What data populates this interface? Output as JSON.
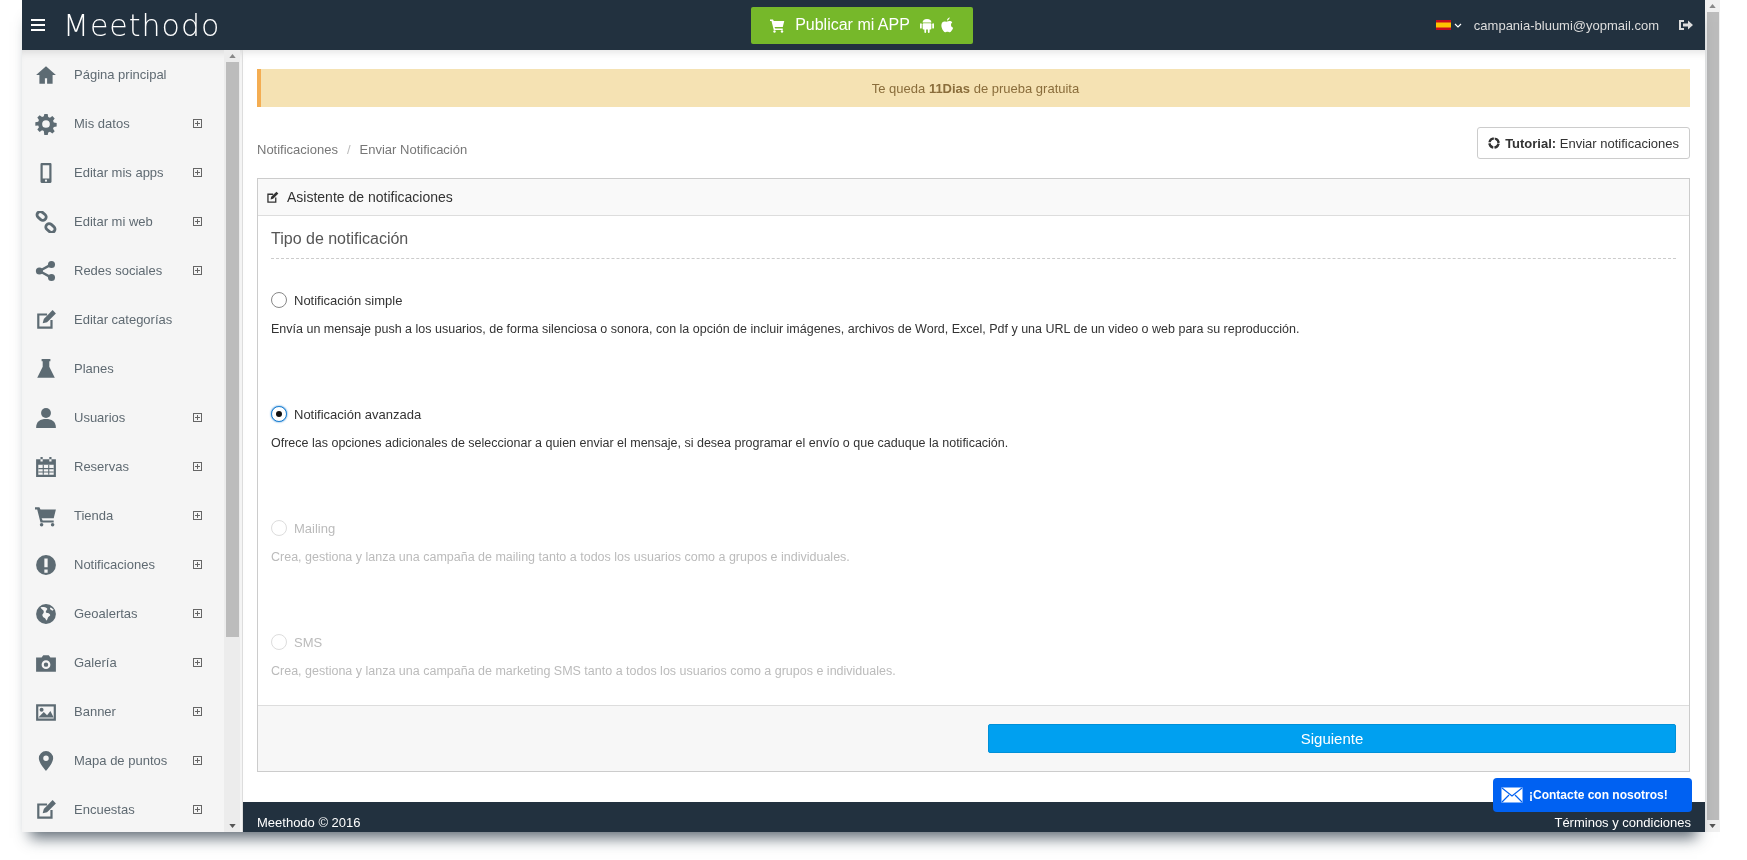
{
  "topbar": {
    "logo": "Meethodo",
    "publish_button": "Publicar mi APP",
    "account_email": "campania-bluumi@yopmail.com"
  },
  "sidebar": {
    "items": [
      {
        "label": "Página principal",
        "expandable": false
      },
      {
        "label": "Mis datos",
        "expandable": true
      },
      {
        "label": "Editar mis apps",
        "expandable": true
      },
      {
        "label": "Editar mi web",
        "expandable": true
      },
      {
        "label": "Redes sociales",
        "expandable": true
      },
      {
        "label": "Editar categorías",
        "expandable": false
      },
      {
        "label": "Planes",
        "expandable": false
      },
      {
        "label": "Usuarios",
        "expandable": true
      },
      {
        "label": "Reservas",
        "expandable": true
      },
      {
        "label": "Tienda",
        "expandable": true
      },
      {
        "label": "Notificaciones",
        "expandable": true
      },
      {
        "label": "Geoalertas",
        "expandable": true
      },
      {
        "label": "Galería",
        "expandable": true
      },
      {
        "label": "Banner",
        "expandable": true
      },
      {
        "label": "Mapa de puntos",
        "expandable": true
      },
      {
        "label": "Encuestas",
        "expandable": true
      }
    ]
  },
  "trial_banner": "Te queda **11Dias** de prueba gratuita",
  "breadcrumb": {
    "separator": "/",
    "items": [
      {
        "label": "Notificaciones"
      },
      {
        "label": "Enviar Notificación"
      }
    ]
  },
  "tutorial_button": "**Tutorial:** Enviar notificaciones",
  "panel": {
    "title": "Asistente de notificaciones",
    "section_title": "Tipo de notificación",
    "options": [
      {
        "label": "Notificación simple",
        "description": "Envía un mensaje push a los usuarios, de forma silenciosa o sonora, con la opción de incluir imágenes, archivos de Word, Excel, Pdf y una URL de un video o web para su reproducción.",
        "selected": false,
        "disabled": false
      },
      {
        "label": "Notificación avanzada",
        "description": "Ofrece las opciones adicionales de seleccionar a quien enviar el mensaje, si desea programar el envío o que caduque la notificación.",
        "selected": true,
        "disabled": false
      },
      {
        "label": "Mailing",
        "description": "Crea, gestiona y lanza una campaña de mailing tanto a todos los usuarios como a grupos e individuales.",
        "selected": false,
        "disabled": true
      },
      {
        "label": "SMS",
        "description": "Crea, gestiona y lanza una campaña de marketing SMS tanto a todos los usuarios como a grupos e individuales.",
        "selected": false,
        "disabled": true
      }
    ],
    "next_button": "Siguiente"
  },
  "footer": {
    "copyright": "Meethodo © 2016",
    "terms_link": "Términos y condiciones"
  },
  "contact_widget": "¡Contacte con nosotros!"
}
